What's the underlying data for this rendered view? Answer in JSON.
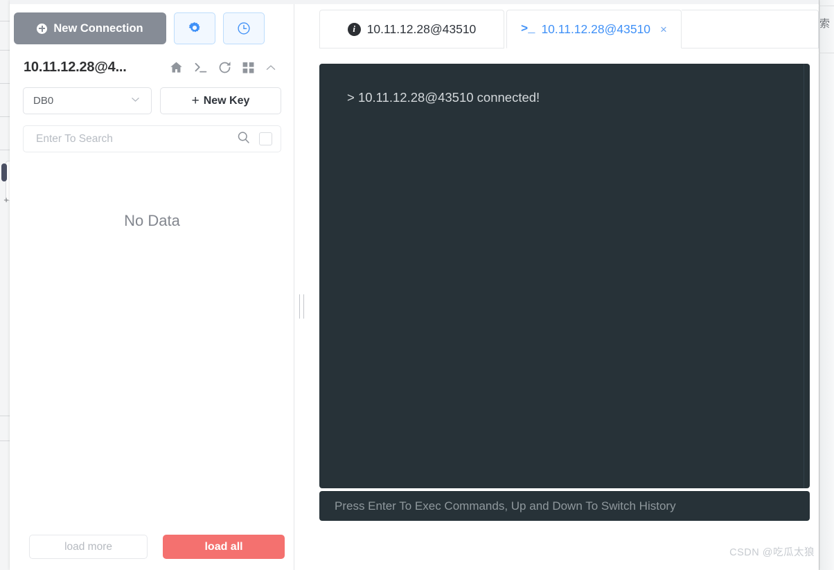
{
  "background": {
    "right_edge_text": "索"
  },
  "sidebar": {
    "new_connection_label": "New Connection",
    "settings_icon": "gear-icon",
    "history_icon": "clock-icon",
    "connection_name": "10.11.12.28@4...",
    "toolbar_icons": [
      {
        "name": "home-icon"
      },
      {
        "name": "terminal-icon"
      },
      {
        "name": "refresh-icon"
      },
      {
        "name": "grid-icon"
      },
      {
        "name": "chevron-up-icon"
      }
    ],
    "db_select_value": "DB0",
    "db_select_options": [
      "DB0"
    ],
    "new_key_label": "New Key",
    "new_key_plus": "+",
    "search_placeholder": "Enter To Search",
    "search_value": "",
    "search_icon": "search-icon",
    "empty_state": "No Data",
    "load_more_label": "load more",
    "load_all_label": "load all",
    "load_all_color": "#f4716f"
  },
  "tabs": [
    {
      "label": "10.11.12.28@43510",
      "icon": "info-icon",
      "icon_glyph": "i",
      "active": false,
      "closable": false
    },
    {
      "label": "10.11.12.28@43510",
      "icon": "terminal-prompt-icon",
      "icon_glyph": ">_",
      "active": true,
      "closable": true,
      "close_glyph": "×",
      "accent_color": "#4091f7"
    }
  ],
  "terminal": {
    "lines": [
      "> 10.11.12.28@43510 connected!"
    ],
    "hint": "Press Enter To Exec Commands, Up and Down To Switch History",
    "background_color": "#273238",
    "text_color": "#d3d8db"
  },
  "watermark": "CSDN @吃瓜太狼"
}
